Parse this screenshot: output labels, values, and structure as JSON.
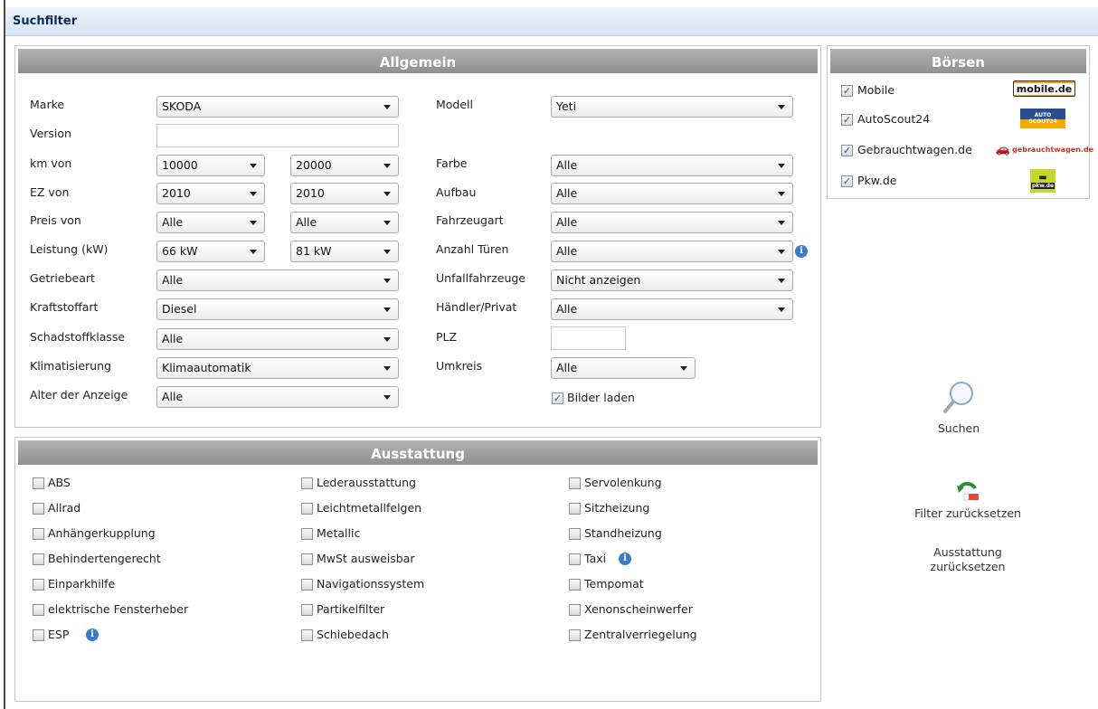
{
  "window_title": "Suchfilter",
  "allgemein": {
    "title": "Allgemein",
    "labels": {
      "marke": "Marke",
      "version": "Version",
      "km": "km von",
      "ez": "EZ von",
      "preis": "Preis von",
      "leistung": "Leistung (kW)",
      "getriebe": "Getriebeart",
      "kraftstoff": "Kraftstoffart",
      "schadstoff": "Schadstoffklasse",
      "klima": "Klimatisierung",
      "alter": "Alter der Anzeige",
      "modell": "Modell",
      "farbe": "Farbe",
      "aufbau": "Aufbau",
      "fahrzeugart": "Fahrzeugart",
      "tueren": "Anzahl Türen",
      "unfall": "Unfallfahrzeuge",
      "haendler": "Händler/Privat",
      "plz": "PLZ",
      "umkreis": "Umkreis"
    },
    "values": {
      "marke": "SKODA",
      "version": "",
      "km_von": "10000",
      "km_bis": "20000",
      "ez_von": "2010",
      "ez_bis": "2010",
      "preis_von": "Alle",
      "preis_bis": "Alle",
      "leistung_von": "66 kW",
      "leistung_bis": "81 kW",
      "getriebe": "Alle",
      "kraftstoff": "Diesel",
      "schadstoff": "Alle",
      "klima": "Klimaautomatik",
      "alter": "Alle",
      "modell": "Yeti",
      "farbe": "Alle",
      "aufbau": "Alle",
      "fahrzeugart": "Alle",
      "tueren": "Alle",
      "unfall": "Nicht anzeigen",
      "haendler": "Alle",
      "plz": "",
      "umkreis": "Alle"
    },
    "bilder_laden": {
      "label": "Bilder laden",
      "checked": true
    }
  },
  "ausstattung": {
    "title": "Ausstattung",
    "col1": [
      "ABS",
      "Allrad",
      "Anhängerkupplung",
      "Behindertengerecht",
      "Einparkhilfe",
      "elektrische Fensterheber",
      "ESP"
    ],
    "col2": [
      "Lederausstattung",
      "Leichtmetallfelgen",
      "Metallic",
      "MwSt ausweisbar",
      "Navigationssystem",
      "Partikelfilter",
      "Schiebedach"
    ],
    "col3": [
      "Servolenkung",
      "Sitzheizung",
      "Standheizung",
      "Taxi",
      "Tempomat",
      "Xenonscheinwerfer",
      "Zentralverriegelung"
    ]
  },
  "boersen": {
    "title": "Börsen",
    "items": [
      {
        "label": "Mobile",
        "checked": true,
        "logo": "mobile.de"
      },
      {
        "label": "AutoScout24",
        "checked": true,
        "logo": "AUTO SCOUT24"
      },
      {
        "label": "Gebrauchtwagen.de",
        "checked": true,
        "logo": "gebrauchtwagen.de"
      },
      {
        "label": "Pkw.de",
        "checked": true,
        "logo": "pkw.de"
      }
    ]
  },
  "actions": {
    "search": "Suchen",
    "reset_filter": "Filter zurücksetzen",
    "reset_ausstattung": "Ausstattung zurücksetzen"
  },
  "colors": {
    "header_gray": "#9d9d9d",
    "title_blue": "#0f2a58",
    "info_blue": "#3b7cc9",
    "mobile_orange": "#f39a24"
  }
}
